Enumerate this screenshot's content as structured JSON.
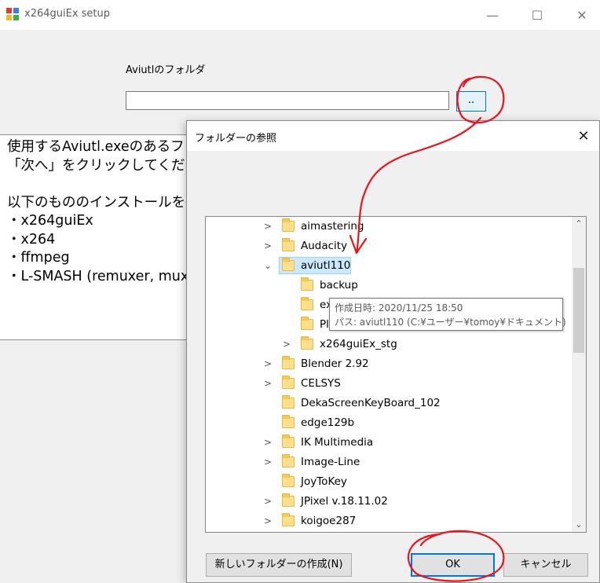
{
  "window": {
    "title": "x264guiEx setup",
    "minimize_symbol": "—",
    "maximize_symbol": "☐",
    "close_symbol": "✕"
  },
  "form": {
    "folder_label": "Aviutlのフォルダ",
    "path_value": "",
    "browse_label": ".."
  },
  "description": {
    "text": "使用するAviutl.exeのあるフォルダ\n「次へ」をクリックしてください。\n\n以下のもののインストールを行い\n・x264guiEx\n・x264\n・ffmpeg\n・L-SMASH (remuxer, muxer"
  },
  "dialog": {
    "title": "フォルダーの参照",
    "close_symbol": "✕",
    "tree": [
      {
        "name": "aimastering",
        "expander": ">",
        "depth": 0
      },
      {
        "name": "Audacity",
        "expander": ">",
        "depth": 0
      },
      {
        "name": "aviutl110",
        "expander": "⌄",
        "depth": 0,
        "selected": true
      },
      {
        "name": "backup",
        "expander": "",
        "depth": 1
      },
      {
        "name": "ex",
        "expander": "",
        "depth": 1
      },
      {
        "name": "Pl",
        "expander": "",
        "depth": 1
      },
      {
        "name": "x264guiEx_stg",
        "expander": ">",
        "depth": 1
      },
      {
        "name": "Blender 2.92",
        "expander": ">",
        "depth": 0
      },
      {
        "name": "CELSYS",
        "expander": ">",
        "depth": 0
      },
      {
        "name": "DekaScreenKeyBoard_102",
        "expander": "",
        "depth": 0
      },
      {
        "name": "edge129b",
        "expander": "",
        "depth": 0
      },
      {
        "name": "IK Multimedia",
        "expander": ">",
        "depth": 0
      },
      {
        "name": "Image-Line",
        "expander": ">",
        "depth": 0
      },
      {
        "name": "JoyToKey",
        "expander": "",
        "depth": 0
      },
      {
        "name": "JPixel v.18.11.02",
        "expander": ">",
        "depth": 0
      },
      {
        "name": "koigoe287",
        "expander": ">",
        "depth": 0
      }
    ],
    "tooltip": {
      "line1": "作成日時: 2020/11/25 18:50",
      "line2": "パス: aviutl110 (C:¥ユーザー¥tomoy¥ドキュメント)"
    },
    "buttons": {
      "new_folder": "新しいフォルダーの作成(N)",
      "ok": "OK",
      "cancel": "キャンセル"
    }
  },
  "colors": {
    "annotation": "#e8141e",
    "accent": "#0078d7",
    "selection": "#cce8ff",
    "folder": "#ffe08a"
  }
}
